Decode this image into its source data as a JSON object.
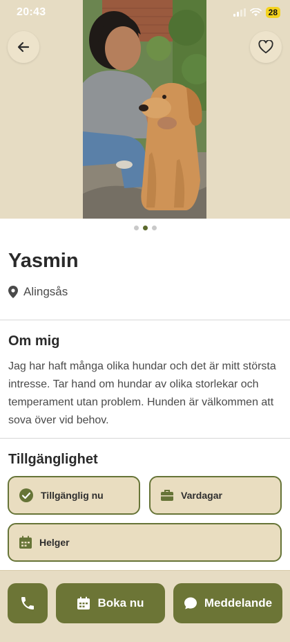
{
  "status_bar": {
    "time": "20:43",
    "battery": "28"
  },
  "hero": {
    "photo_count": 3,
    "active_photo": 2
  },
  "profile": {
    "name": "Yasmin",
    "location": "Alingsås"
  },
  "about": {
    "title": "Om mig",
    "text": "Jag har haft många olika hundar och det är mitt största intresse. Tar hand om hundar av olika storlekar och temperament utan problem. Hunden är välkommen att sova över vid behov."
  },
  "availability": {
    "title": "Tillgänglighet",
    "chips": [
      {
        "label": "Tillgänglig nu",
        "icon": "check-circle-icon"
      },
      {
        "label": "Vardagar",
        "icon": "briefcase-icon"
      },
      {
        "label": "Helger",
        "icon": "calendar-icon"
      }
    ]
  },
  "actions": {
    "call_icon": "phone-icon",
    "book_label": "Boka nu",
    "message_label": "Meddelande"
  },
  "colors": {
    "accent": "#6c7536",
    "chip_border": "#667437",
    "cream": "#e6dcc3"
  }
}
